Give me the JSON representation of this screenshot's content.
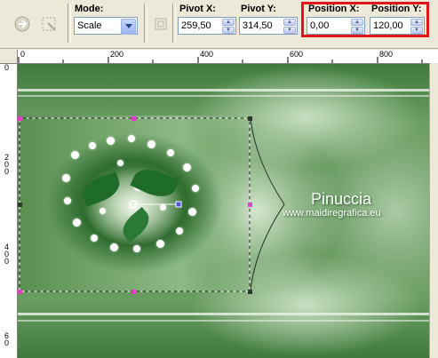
{
  "toolbar": {
    "mode_label": "Mode:",
    "mode_value": "Scale",
    "pivot_x_label": "Pivot X:",
    "pivot_x_value": "259,50",
    "pivot_y_label": "Pivot Y:",
    "pivot_y_value": "314,50",
    "position_x_label": "Position X:",
    "position_x_value": "0,00",
    "position_y_label": "Position Y:",
    "position_y_value": "120,00"
  },
  "ruler": {
    "top_ticks": [
      "0",
      "200",
      "400",
      "600",
      "800"
    ],
    "left_ticks": [
      "0",
      "2\n0\n0",
      "4\n0\n0",
      "6\n0"
    ]
  },
  "watermark": {
    "name": "Pinuccia",
    "url": "www.maidiregrafica.eu"
  },
  "colors": {
    "highlight": "#e0161b",
    "handle": "#e040c8",
    "canvas_green": "#4b8444"
  }
}
